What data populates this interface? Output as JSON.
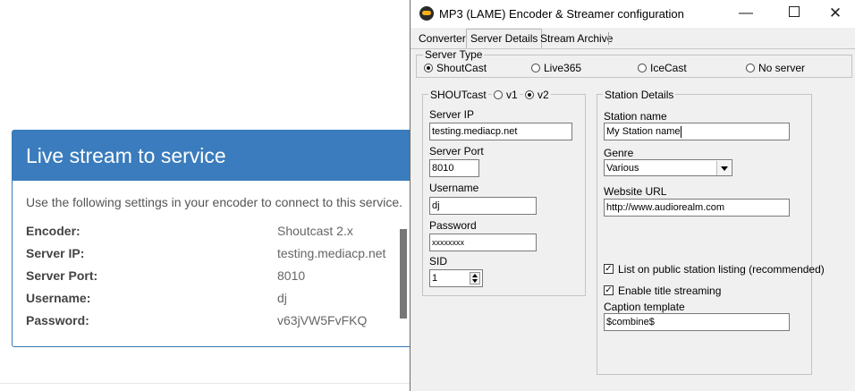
{
  "web": {
    "panel_title": "Live stream to service",
    "intro": "Use the following settings in your encoder to connect to this service.",
    "rows": [
      {
        "label": "Encoder:",
        "value": "Shoutcast 2.x"
      },
      {
        "label": "Server IP:",
        "value": "testing.mediacp.net"
      },
      {
        "label": "Server Port:",
        "value": "8010"
      },
      {
        "label": "Username:",
        "value": "dj"
      },
      {
        "label": "Password:",
        "value": "v63jVW5FvFKQ"
      }
    ]
  },
  "dialog": {
    "title": "MP3 (LAME) Encoder & Streamer configuration",
    "controls": {
      "minimize": "—",
      "close": "✕"
    },
    "tabs": [
      "Converter",
      "Server Details",
      "Stream Archive"
    ],
    "active_tab": "Server Details",
    "server_type": {
      "legend": "Server Type",
      "options": [
        "ShoutCast",
        "Live365",
        "IceCast",
        "No server"
      ],
      "selected": "ShoutCast"
    },
    "shoutcast": {
      "legend": "SHOUTcast",
      "versions": [
        "v1",
        "v2"
      ],
      "selected_version": "v2",
      "server_ip_label": "Server IP",
      "server_ip": "testing.mediacp.net",
      "server_port_label": "Server Port",
      "server_port": "8010",
      "username_label": "Username",
      "username": "dj",
      "password_label": "Password",
      "password": "xxxxxxxx",
      "sid_label": "SID",
      "sid": "1"
    },
    "station": {
      "legend": "Station Details",
      "name_label": "Station name",
      "name": "My Station name",
      "genre_label": "Genre",
      "genre": "Various",
      "website_label": "Website URL",
      "website": "http://www.audiorealm.com",
      "list_public_label": "List on public station listing (recommended)",
      "list_public_checked": true,
      "title_streaming_label": "Enable title streaming",
      "title_streaming_checked": true,
      "caption_label": "Caption template",
      "caption": "$combine$"
    }
  }
}
